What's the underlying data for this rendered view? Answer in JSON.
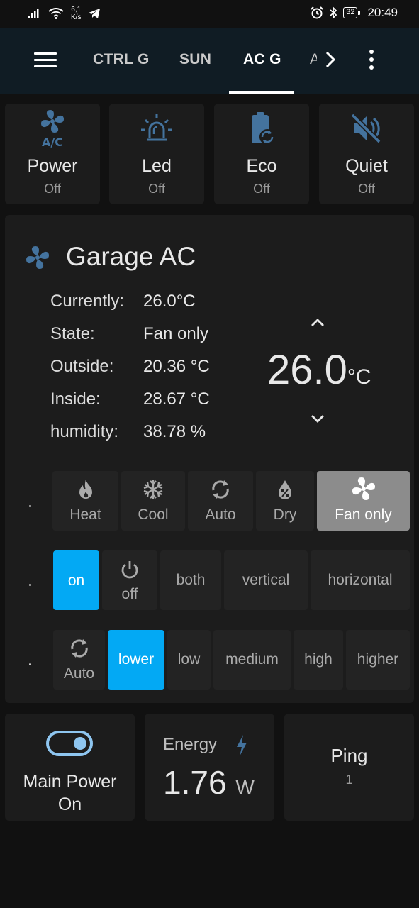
{
  "status_bar": {
    "net_speed_value": "6,1",
    "net_speed_unit": "K/s",
    "battery": "32",
    "time": "20:49"
  },
  "header": {
    "tabs": [
      {
        "label": "CTRL G"
      },
      {
        "label": "SUN"
      },
      {
        "label": "AC G"
      },
      {
        "label": "A"
      }
    ],
    "active_tab": "AC G"
  },
  "buttons": [
    {
      "name": "Power",
      "state": "Off",
      "icon": "ac-fan-icon"
    },
    {
      "name": "Led",
      "state": "Off",
      "icon": "alarm-light-icon"
    },
    {
      "name": "Eco",
      "state": "Off",
      "icon": "battery-eco-icon"
    },
    {
      "name": "Quiet",
      "state": "Off",
      "icon": "volume-off-icon"
    }
  ],
  "climate": {
    "title": "Garage AC",
    "attributes": [
      {
        "label": "Currently:",
        "value": "26.0°C"
      },
      {
        "label": "State:",
        "value": "Fan only"
      },
      {
        "label": "Outside:",
        "value": "20.36 °C"
      },
      {
        "label": "Inside:",
        "value": "28.67 °C"
      },
      {
        "label": "humidity:",
        "value": "38.78 %"
      }
    ],
    "target_temperature": "26.0",
    "target_unit": "°C",
    "hvac_modes": [
      {
        "label": "Heat",
        "icon": "fire-icon"
      },
      {
        "label": "Cool",
        "icon": "snowflake-icon"
      },
      {
        "label": "Auto",
        "icon": "autorenew-icon"
      },
      {
        "label": "Dry",
        "icon": "water-percent-icon"
      },
      {
        "label": "Fan only",
        "icon": "fan-icon",
        "active": true
      }
    ],
    "swing_modes": [
      {
        "label": "on",
        "active": true
      },
      {
        "label": "off",
        "icon": "power-icon"
      },
      {
        "label": "both"
      },
      {
        "label": "vertical"
      },
      {
        "label": "horizontal"
      }
    ],
    "fan_modes": [
      {
        "label": "Auto",
        "icon": "autorenew-icon"
      },
      {
        "label": "lower",
        "active": true
      },
      {
        "label": "low"
      },
      {
        "label": "medium"
      },
      {
        "label": "high"
      },
      {
        "label": "higher"
      }
    ],
    "accent_color": "#03a9f4",
    "active_mode_color": "#8c8c8c"
  },
  "main_power": {
    "name": "Main Power",
    "state": "On",
    "icon": "toggle-switch-icon"
  },
  "energy": {
    "label": "Energy",
    "value": "1.76",
    "unit": "W",
    "icon": "flash-icon"
  },
  "ping": {
    "label": "Ping",
    "value": "1"
  },
  "icon_color": "#44739e"
}
